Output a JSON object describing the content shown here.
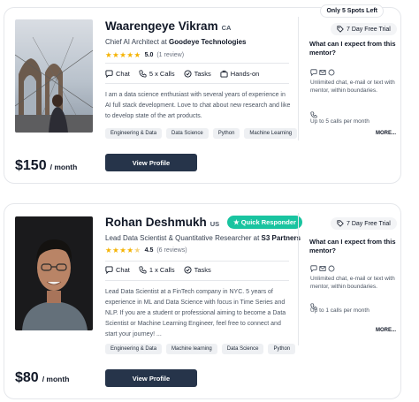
{
  "mentors": [
    {
      "spots_badge": "Only 5 Spots Left",
      "name": "Waarengeye Vikram",
      "country": "CA",
      "role_prefix": "Chief AI Architect at ",
      "company": "Goodeye Technologies",
      "rating": "5.0",
      "rating_value": 5.0,
      "reviews": "(1 review)",
      "features": [
        "Chat",
        "5 x Calls",
        "Tasks",
        "Hands-on"
      ],
      "bio": "I am a data science enthusiast with several years of experience in AI full stack development. Love to chat about new research and like to develop state of the art products.",
      "tags": [
        "Engineering & Data",
        "Data Science",
        "Python",
        "Machine Learning"
      ],
      "price": "$150",
      "price_unit": "/ month",
      "button": "View Profile",
      "trial": "7 Day Free Trial",
      "side_question": "What can I expect from this mentor?",
      "side_contact": "Unlimited chat, e-mail or text with mentor, within boundaries.",
      "side_calls": "Up to 5 calls per month",
      "more": "MORE..."
    },
    {
      "quick_badge": "★ Quick Responder",
      "name": "Rohan Deshmukh",
      "country": "US",
      "role_prefix": "Lead Data Scientist & Quantitative Researcher at ",
      "company": "S3 Partners",
      "rating": "4.5",
      "rating_value": 4.5,
      "reviews": "(6 reviews)",
      "features": [
        "Chat",
        "1 x Calls",
        "Tasks"
      ],
      "bio": "Lead Data Scientist at a FinTech company in NYC. 5 years of experience in ML and Data Science with focus in Time Series and NLP. If you are a student or professional aiming to become a Data Scientist or Machine Learning Engineer, feel free to connect and start your journey! ...",
      "tags": [
        "Engineering & Data",
        "Machine learning",
        "Data Science",
        "Python"
      ],
      "price": "$80",
      "price_unit": "/ month",
      "button": "View Profile",
      "trial": "7 Day Free Trial",
      "side_question": "What can I expect from this mentor?",
      "side_contact": "Unlimited chat, e-mail or text with mentor, within boundaries.",
      "side_calls": "Up to 1 calls per month",
      "more": "MORE..."
    }
  ],
  "colors": {
    "primary_button": "#26344a",
    "star": "#f5b301",
    "quick_badge": "#19c4a0"
  },
  "icons": {
    "features": [
      "chat-icon",
      "phone-icon",
      "tasks-icon",
      "hands-on-icon"
    ],
    "trial": "tag-icon"
  }
}
